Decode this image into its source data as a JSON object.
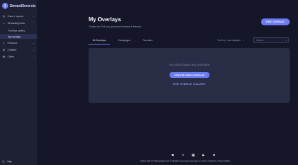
{
  "app": {
    "logo_text": "StreamElements",
    "logo_badge": "S"
  },
  "sidebar": {
    "items": [
      {
        "label": "Data & reports",
        "icon": "chart-icon"
      },
      {
        "label": "Streaming tools",
        "icon": "video-icon"
      },
      {
        "label": "Revenue",
        "icon": "dollar-icon"
      },
      {
        "label": "Chatbot",
        "icon": "chat-icon"
      },
      {
        "label": "Other",
        "icon": "grid-icon"
      }
    ],
    "sub_items": [
      {
        "label": "Overlays gallery"
      },
      {
        "label": "My overlays",
        "active": true
      }
    ],
    "help_label": "Help"
  },
  "page": {
    "title": "My Overlays",
    "subtitle": "Create and Edit your personal overlays & themes",
    "new_overlay_label": "NEW OVERLAY"
  },
  "tabs": [
    {
      "label": "All Overlays",
      "active": true
    },
    {
      "label": "Campaigns"
    },
    {
      "label": "Favorites"
    }
  ],
  "sort": {
    "label": "Sort by: Last updated",
    "chevron": "chevron-down-icon"
  },
  "search": {
    "placeholder": "Search"
  },
  "empty_state": {
    "message": "You don't have any overlays",
    "create_label": "CREATE NEW OVERLAY",
    "gallery_label": "VISIT OVERLAY GALLERY"
  },
  "footer": {
    "socials": [
      "instagram-icon",
      "twitter-icon",
      "facebook-icon",
      "youtube-icon",
      "discord-icon"
    ],
    "crafted_prefix": "Crafted with",
    "crafted_by": "by",
    "brand": "StreamElements",
    "rest": "© All rights reserved to Carnegie Inc",
    "terms": "Terms of Service",
    "privacy": "Privacy Policy"
  },
  "colors": {
    "accent": "#6c7cf5",
    "sidebar": "#1e2034",
    "background": "#151728",
    "panel": "#2a2d46"
  }
}
